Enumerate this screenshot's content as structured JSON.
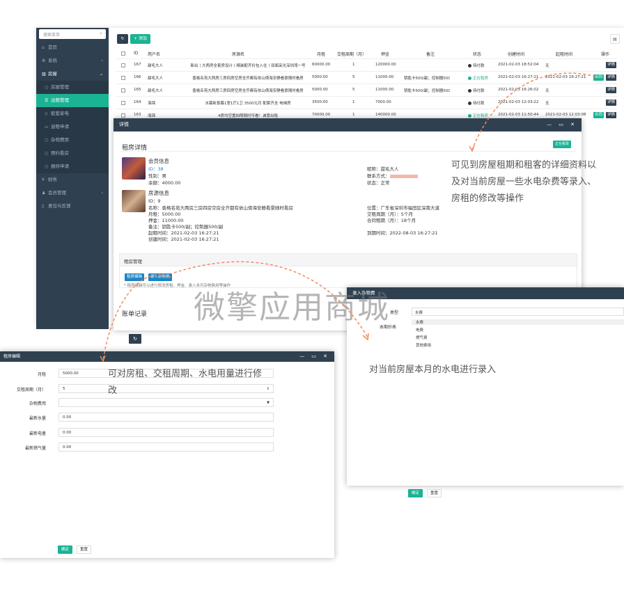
{
  "sidebar": {
    "search_placeholder": "搜索菜单",
    "items": [
      {
        "label": "首页"
      },
      {
        "label": "系统"
      },
      {
        "label": "房屋"
      },
      {
        "label": "房屋管理"
      },
      {
        "label": "出租管理"
      },
      {
        "label": "配套家电"
      },
      {
        "label": "退租申请"
      },
      {
        "label": "杂物费用"
      },
      {
        "label": "预约看房"
      },
      {
        "label": "报修申请"
      },
      {
        "label": "财务"
      },
      {
        "label": "会员管理"
      },
      {
        "label": "意见与反馈"
      }
    ]
  },
  "toolbar": {
    "add_label": "+ 添加"
  },
  "table": {
    "headers": [
      "ID",
      "用户名",
      "房源名",
      "月租",
      "交租周期（月）",
      "押金",
      "备注",
      "状态",
      "创建时间",
      "起租时间",
      "操作"
    ],
    "rows": [
      {
        "id": "167",
        "user": "甜毛大人",
        "house": "新出丨大两房全套房设计丨精装配齐拎包入住丨双面采光深圳湾一号",
        "rent": "60000.00",
        "period": "1",
        "deposit": "120000.00",
        "note": "",
        "status": "待付款",
        "status_color": "#333",
        "created": "2021-02-03 18:52:04",
        "start": "无",
        "ops": [
          "详情"
        ]
      },
      {
        "id": "166",
        "user": "甜毛大人",
        "house": "香格名苑大两房三房四房空房全齐都有依山傍海安静看景随时看房",
        "rent": "5000.00",
        "period": "5",
        "deposit": "11000.00",
        "note": "钥匙卡500/副；控制器500/副",
        "status": "正在租房",
        "status_color": "#1ab394",
        "created": "2021-02-03 16:27:21",
        "start": "2021-02-03 16:27:21",
        "ops": [
          "合同",
          "详情"
        ]
      },
      {
        "id": "165",
        "user": "甜毛大人",
        "house": "香格名苑大两房三房四房空房全齐都有依山傍海安静看景随时看房",
        "rent": "5000.00",
        "period": "5",
        "deposit": "11000.00",
        "note": "钥匙卡500/副；控制器500/副",
        "status": "待付款",
        "status_color": "#333",
        "created": "2021-02-03 16:26:02",
        "start": "无",
        "ops": [
          "详情"
        ]
      },
      {
        "id": "164",
        "user": "海锦",
        "house": "水幕新景幕1室1厅1卫 3500元月 配套齐全 电梯房",
        "rent": "3500.00",
        "period": "1",
        "deposit": "7000.00",
        "note": "",
        "status": "待付款",
        "status_color": "#333",
        "created": "2021-02-03 12:03:22",
        "start": "无",
        "ops": [
          "详情"
        ]
      },
      {
        "id": "163",
        "user": "海锦",
        "house": "4房均空置拍照随时可看！诚意出租",
        "rent": "70000.00",
        "period": "1",
        "deposit": "140000.00",
        "note": "",
        "status": "正在租房",
        "status_color": "#1ab394",
        "created": "2021-02-03 11:50:44",
        "start": "2021-02-03 12:03:08",
        "ops": [
          "合同",
          "详情"
        ]
      }
    ]
  },
  "detail": {
    "title": "详情",
    "heading": "租房详情",
    "badge": "正在租赁",
    "member_title": "会员信息",
    "member_id": "ID：38",
    "gender": "性别：男",
    "balance": "余额：4000.00",
    "nickname": "昵称：甜毛大人",
    "contact": "联系方式：",
    "member_status": "状态：正常",
    "house_title": "房源信息",
    "house_id": "ID：9",
    "house_name": "名称：香格名苑大两房三房四房空房全齐都有依山傍海安静看景随时看房",
    "house_rent": "月租：5000.00",
    "house_deposit": "押金：11000.00",
    "house_note": "备注：钥匙卡500/副；控制器500/副",
    "house_start": "起租时间：2021-02-03 16:27:21",
    "house_created": "创建时间：2021-02-03 16:27:21",
    "location": "位置：广东省深圳市福田区深南大道",
    "pay_period": "交租周期（月）：5个月",
    "contract_period": "合同租期（月）：18个月",
    "expire": "到期时间：2022-08-03 16:27:21",
    "manage_title": "租房管理",
    "edit_btn": "租房编辑",
    "misc_btn": "录入杂物费",
    "hint": "* 租房编辑可以进行修改房租、押金、录入本月杂物费用等操作",
    "bill_title": "账单记录"
  },
  "edit": {
    "title": "租房编辑",
    "fields": [
      {
        "label": "月租",
        "value": "5000.00"
      },
      {
        "label": "交租周期（月）",
        "value": "5"
      },
      {
        "label": "杂物费用",
        "value": ""
      },
      {
        "label": "最新水量",
        "value": "0.00"
      },
      {
        "label": "最新电量",
        "value": "0.00"
      },
      {
        "label": "最新燃气量",
        "value": "0.00"
      }
    ],
    "ok": "确定",
    "reset": "重置"
  },
  "misc": {
    "title": "录入杂物费",
    "type_label": "类型",
    "amount_label": "本期抄表",
    "selected": "水费",
    "options": [
      "水费",
      "电费",
      "燃气费",
      "其他费用"
    ],
    "ok": "确定",
    "reset": "重置"
  },
  "annotations": {
    "a1": "可见到房屋租期和租客的详细资料以及对当前房屋一些水电杂费等录入、房租的修改等操作",
    "a2": "可对房租、交租周期、水电用量进行修改",
    "a3": "对当前房屋本月的水电进行录入"
  },
  "watermark": "微擎应用商城",
  "colors": {
    "accent": "#1ab394",
    "sidebar": "#2f4050",
    "header": "#2f4050",
    "blue_btn": "#1c84c6",
    "arrow": "#f08a5d"
  }
}
